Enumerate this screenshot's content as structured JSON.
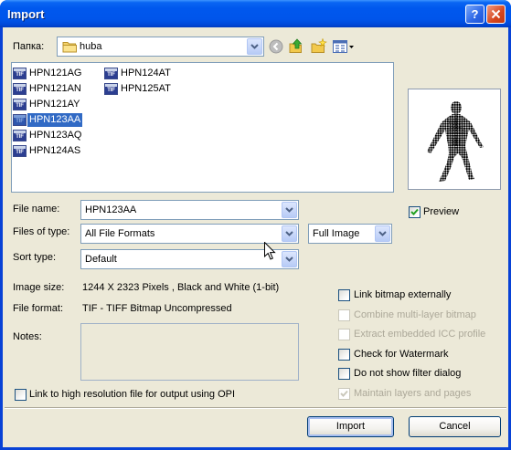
{
  "window": {
    "title": "Import",
    "help_button": "?",
    "help_icon": "help-icon",
    "close_icon": "close-icon"
  },
  "look_in": {
    "label": "Папка:",
    "current_folder": "huba",
    "folder_icon": "folder-icon",
    "toolbar_icons": [
      "back-arrow-icon",
      "up-one-level-icon",
      "new-folder-icon",
      "view-menu-icon"
    ]
  },
  "file_list": {
    "icon": "tif-file-icon",
    "icon_badge": "TIF",
    "items": [
      {
        "name": "HPN121AG",
        "selected": false
      },
      {
        "name": "HPN121AN",
        "selected": false
      },
      {
        "name": "HPN121AY",
        "selected": false
      },
      {
        "name": "HPN123AA",
        "selected": true
      },
      {
        "name": "HPN123AQ",
        "selected": false
      },
      {
        "name": "HPN124AS",
        "selected": false
      },
      {
        "name": "HPN124AT",
        "selected": false
      },
      {
        "name": "HPN125AT",
        "selected": false
      }
    ]
  },
  "preview": {
    "label": "Preview",
    "checked": true,
    "enabled": true
  },
  "form": {
    "file_name": {
      "label": "File name:",
      "value": "HPN123AA"
    },
    "files_of_type": {
      "label": "Files of type:",
      "value": "All File Formats"
    },
    "image_option": {
      "value": "Full Image"
    },
    "sort_type": {
      "label": "Sort type:",
      "value": "Default"
    },
    "image_size": {
      "label": "Image size:",
      "value": "1244 X 2323 Pixels , Black and White (1-bit)"
    },
    "file_format": {
      "label": "File format:",
      "value": "TIF - TIFF Bitmap Uncompressed"
    },
    "notes": {
      "label": "Notes:"
    }
  },
  "options": [
    {
      "label": "Link bitmap externally",
      "checked": false,
      "enabled": true
    },
    {
      "label": "Combine multi-layer bitmap",
      "checked": false,
      "enabled": false
    },
    {
      "label": "Extract embedded ICC profile",
      "checked": false,
      "enabled": false
    },
    {
      "label": "Check for Watermark",
      "checked": false,
      "enabled": true
    },
    {
      "label": "Do not show filter dialog",
      "checked": false,
      "enabled": true
    },
    {
      "label": "Maintain layers and pages",
      "checked": true,
      "enabled": false
    }
  ],
  "opi_link": {
    "label": "Link to high resolution file for output using OPI",
    "checked": false,
    "enabled": true
  },
  "buttons": {
    "import": "Import",
    "cancel": "Cancel"
  },
  "colors": {
    "title_bar": "#0058EE",
    "dialog_background": "#ECE9D8",
    "selection": "#316AC5",
    "checkmark": "#21A121",
    "disabled_text": "#ACA899",
    "field_border": "#7F9DB9"
  }
}
